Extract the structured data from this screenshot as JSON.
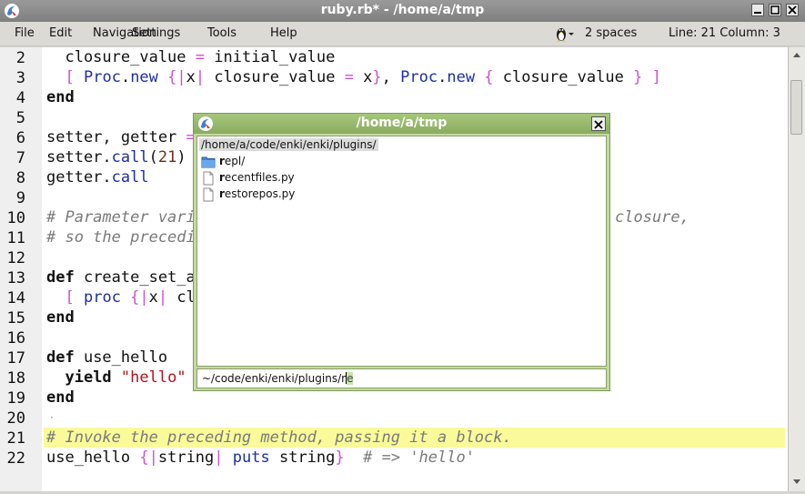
{
  "window": {
    "title": "ruby.rb* - /home/a/tmp",
    "icons": {
      "app": "enki-logo-icon",
      "minimize": "minimize-icon",
      "maximize": "maximize-icon",
      "close": "close-icon"
    }
  },
  "menu": {
    "items": [
      "File",
      "Edit",
      "Navigation",
      "Settings",
      "Tools",
      "Help"
    ]
  },
  "status": {
    "indent": "2 spaces",
    "position": "Line: 21 Column: 3"
  },
  "editor": {
    "lines": [
      {
        "num": "2"
      },
      {
        "num": "3"
      },
      {
        "num": "4"
      },
      {
        "num": "5"
      },
      {
        "num": "6"
      },
      {
        "num": "7"
      },
      {
        "num": "8"
      },
      {
        "num": "9"
      },
      {
        "num": "10"
      },
      {
        "num": "11"
      },
      {
        "num": "12"
      },
      {
        "num": "13"
      },
      {
        "num": "14"
      },
      {
        "num": "15"
      },
      {
        "num": "16"
      },
      {
        "num": "17"
      },
      {
        "num": "18"
      },
      {
        "num": "19"
      },
      {
        "num": "20"
      },
      {
        "num": "21"
      },
      {
        "num": "22"
      }
    ],
    "code": {
      "l2": {
        "a": "  closure_value ",
        "op": "=",
        "b": " initial_value"
      },
      "l3": {
        "ind": "  ",
        "lb": "[",
        "sp": " ",
        "cls1": "Proc",
        "dot1": ".",
        "new1": "new",
        "br1o": " {",
        "p1": "|",
        "x": "x",
        "p2": "|",
        "mid1": " closure_value ",
        "eq": "=",
        "mid2": " x",
        "br1c": "}",
        "comma": ", ",
        "cls2": "Proc",
        "dot2": ".",
        "new2": "new",
        "br2o": " {",
        "mid3": " closure_value ",
        "br2c": "}",
        "rb": " ]"
      },
      "l4": {
        "kw": "end"
      },
      "l6": {
        "a": "setter, getter ",
        "op": "="
      },
      "l7": {
        "a": "setter",
        "dot": ".",
        "m": "call",
        "po": "(",
        "num": "21",
        "pc": ")"
      },
      "l8": {
        "a": "getter",
        "dot": ".",
        "m": "call"
      },
      "l10": {
        "c1": "# Parameter vari",
        "c2": "closure,"
      },
      "l11": {
        "c1": "# so the precedi"
      },
      "l13": {
        "kw": "def",
        "a": " create_set_a"
      },
      "l14": {
        "ind": "  ",
        "lb": "[",
        "sp": " ",
        "m": "proc",
        "bo": " {",
        "p1": "|",
        "x": "x",
        "p2": "|",
        "a": " cl"
      },
      "l15": {
        "kw": "end"
      },
      "l17": {
        "kw": "def",
        "a": " use_hello"
      },
      "l18": {
        "ind": "  ",
        "kw": "yield",
        "sp": " ",
        "str": "\"hello\""
      },
      "l19": {
        "kw": "end"
      },
      "l20": {
        "dot": "·"
      },
      "l21": {
        "cmt": "# Invoke the preceding method, passing it a block."
      },
      "l22": {
        "a": "use_hello ",
        "bo": "{",
        "p1": "|",
        "s": "string",
        "p2": "|",
        "sp": " ",
        "m": "puts",
        "b": " string",
        "bc": "}",
        "sp2": "  ",
        "cmt": "# => ",
        "sym": "'hello'"
      }
    }
  },
  "dialog": {
    "title": "/home/a/tmp",
    "icons": {
      "app": "enki-logo-icon",
      "close": "close-icon",
      "folder": "folder-icon",
      "file": "file-icon"
    },
    "current_dir": "/home/a/code/enki/enki/plugins/",
    "entries": [
      {
        "bold": "r",
        "rest": "epl/",
        "type": "folder"
      },
      {
        "bold": "r",
        "rest": "ecentfiles.py",
        "type": "file"
      },
      {
        "bold": "r",
        "rest": "estorepos.py",
        "type": "file"
      }
    ],
    "input": {
      "value": "~/code/enki/enki/plugins/r",
      "completion": "e"
    }
  },
  "colors": {
    "current_line": "#fafa9a",
    "dialog_accent": "#89ac5e",
    "keyword": "#111111",
    "string": "#b0141e",
    "class": "#1e2fa0",
    "operator": "#d050d0",
    "comment": "#7a7a7a"
  }
}
